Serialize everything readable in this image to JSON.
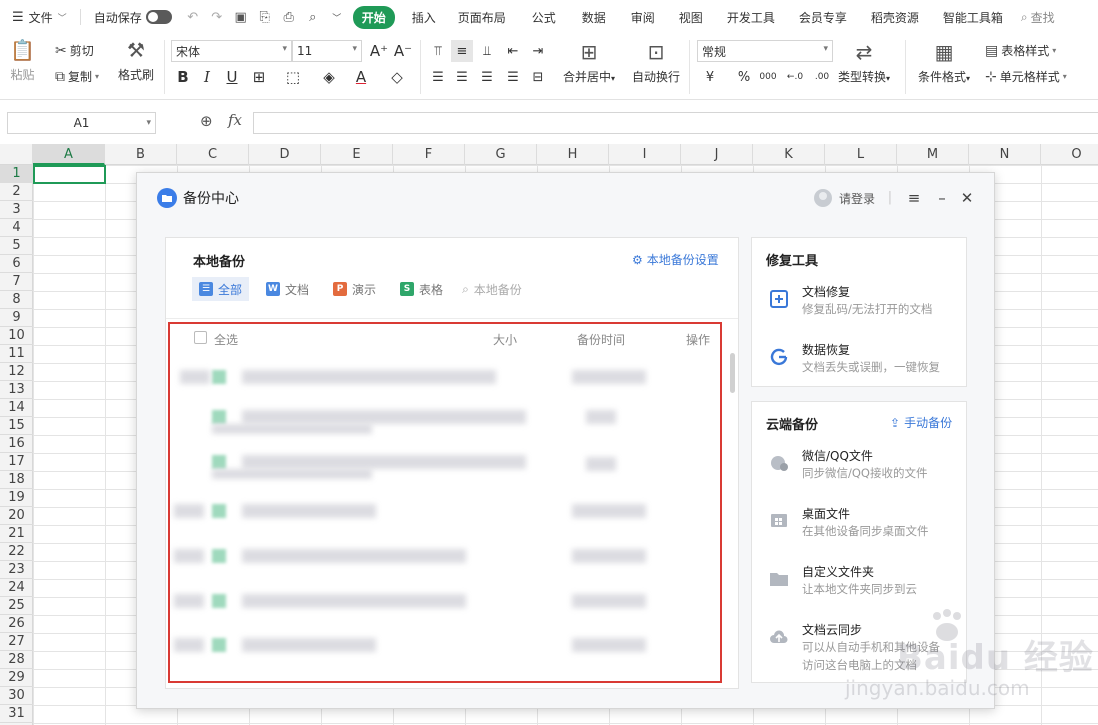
{
  "menubar": {
    "file": "文件",
    "autosave": "自动保存",
    "tabs": [
      "开始",
      "插入",
      "页面布局",
      "公式",
      "数据",
      "审阅",
      "视图",
      "开发工具",
      "会员专享",
      "稻壳资源",
      "智能工具箱"
    ],
    "active_tab": "开始",
    "search": "查找"
  },
  "ribbon": {
    "paste": "粘贴",
    "cut": "剪切",
    "copy": "复制",
    "format_painter": "格式刷",
    "font_name": "宋体",
    "font_size": "11",
    "merge_center": "合并居中",
    "wrap_text": "自动换行",
    "number_format": "常规",
    "type_convert": "类型转换",
    "conditional_format": "条件格式",
    "table_style": "表格样式",
    "cell_style": "单元格样式",
    "currency": "¥",
    "percent": "%",
    "thousands": "000"
  },
  "formula_bar": {
    "name_box": "A1",
    "fx": "fx",
    "value": ""
  },
  "grid": {
    "columns": [
      "A",
      "B",
      "C",
      "D",
      "E",
      "F",
      "G",
      "H",
      "I",
      "J",
      "K",
      "L",
      "M",
      "N",
      "O"
    ],
    "rows": [
      "1",
      "2",
      "3",
      "4",
      "5",
      "6",
      "7",
      "8",
      "9",
      "10",
      "11",
      "12",
      "13",
      "14",
      "15",
      "16",
      "17",
      "18",
      "19",
      "20",
      "21",
      "22",
      "23",
      "24",
      "25",
      "26",
      "27",
      "28",
      "29",
      "30",
      "31"
    ],
    "selected_cell": "A1"
  },
  "dialog": {
    "title": "备份中心",
    "login": "请登录",
    "local": {
      "title": "本地备份",
      "settings": "本地备份设置",
      "filters": [
        "全部",
        "文档",
        "演示",
        "表格"
      ],
      "active_filter": "全部",
      "search_placeholder": "本地备份",
      "headers": {
        "select_all": "全选",
        "size": "大小",
        "backup_time": "备份时间",
        "action": "操作"
      }
    },
    "repair": {
      "title": "修复工具",
      "items": [
        {
          "name": "文档修复",
          "desc": "修复乱码/无法打开的文档"
        },
        {
          "name": "数据恢复",
          "desc": "文档丢失或误删，一键恢复"
        }
      ]
    },
    "cloud": {
      "title": "云端备份",
      "manual": "手动备份",
      "items": [
        {
          "name": "微信/QQ文件",
          "desc": "同步微信/QQ接收的文件"
        },
        {
          "name": "桌面文件",
          "desc": "在其他设备同步桌面文件"
        },
        {
          "name": "自定义文件夹",
          "desc": "让本地文件夹同步到云"
        },
        {
          "name": "文档云同步",
          "desc": "可以从自动手机和其他设备",
          "desc2": "访问这台电脑上的文档"
        }
      ]
    }
  },
  "watermark": {
    "main": "Baidu 经验",
    "sub": "jingyan.baidu.com"
  },
  "colors": {
    "accent_green": "#1f9a57",
    "link_blue": "#3a78d8",
    "highlight_red": "#d93a34"
  }
}
